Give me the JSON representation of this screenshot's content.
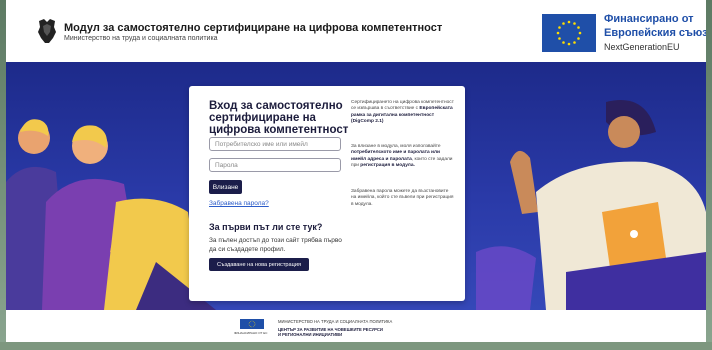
{
  "header": {
    "title": "Модул за самостоятелно сертифициране на цифрова компетентност",
    "subtitle": "Министерство на труда и социалната политика",
    "crest_icon": "crest-lion-icon"
  },
  "eu_badge": {
    "line1": "Финансирано от",
    "line2": "Европейския съюз",
    "line3": "NextGenerationEU",
    "flag_icon": "eu-flag-icon",
    "color": "#1f4fa8"
  },
  "login": {
    "title": "Вход за самостоятелно сертифициране на цифрова компетентност",
    "username_placeholder": "Потребителско име или имейл",
    "password_placeholder": "Парола",
    "login_button": "Влизане",
    "forgot_link": "Забравена парола?"
  },
  "register": {
    "heading": "За първи път ли сте тук?",
    "description": "За пълен достъп до този сайт трябва първо да си създадете профил.",
    "button": "Създаване на нова регистрация"
  },
  "info": {
    "p1_a": "Сертифицирането на цифрова компетентност се извършва в съответствие с ",
    "p1_b": "Европейската рамка за дигитална компетентност (DigComp 2.1)",
    "p2_a": "За влизане в модула, моля използвайте ",
    "p2_b": "потребителското име и паролата или имейл адреса и паролата",
    "p2_c": ", които сте задали при ",
    "p2_d": "регистрация в модула.",
    "p3": "Забравена парола можете да възстановите на имейла, който сте въвели при регистрация в модула."
  },
  "footer": {
    "flag_caption": "ФИНАНСИРАНО ОТ ЕС",
    "line1": "МИНИСТЕРСТВО НА ТРУДА И СОЦИАЛНАТА ПОЛИТИКА",
    "line2": "ЦЕНТЪР ЗА РАЗВИТИЕ НА ЧОВЕШКИТЕ РЕСУРСИ",
    "line3": "И РЕГИОНАЛНИ ИНИЦИАТИВИ"
  },
  "colors": {
    "hero_blue": "#2a3aa8",
    "primary_button": "#1b1d4a",
    "link": "#2c5cc9"
  }
}
